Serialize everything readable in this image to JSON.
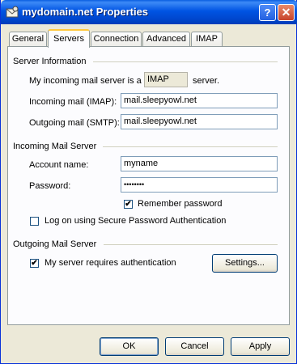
{
  "window": {
    "title": "mydomain.net Properties",
    "help_glyph": "?",
    "close_glyph": "✕",
    "accent": "#0054e3"
  },
  "tabs": [
    {
      "label": "General",
      "active": false
    },
    {
      "label": "Servers",
      "active": true
    },
    {
      "label": "Connection",
      "active": false
    },
    {
      "label": "Advanced",
      "active": false
    },
    {
      "label": "IMAP",
      "active": false
    }
  ],
  "server_info": {
    "heading": "Server Information",
    "incoming_prefix": "My incoming mail server is a",
    "server_type": "IMAP",
    "incoming_suffix": "server.",
    "incoming_label": "Incoming mail (IMAP):",
    "incoming_value": "mail.sleepyowl.net",
    "outgoing_label": "Outgoing mail (SMTP):",
    "outgoing_value": "mail.sleepyowl.net"
  },
  "incoming_server": {
    "heading": "Incoming Mail Server",
    "account_label": "Account name:",
    "account_value": "myname",
    "password_label": "Password:",
    "password_value": "••••••••",
    "remember_label": "Remember password",
    "remember_checked": true,
    "spa_label": "Log on using Secure Password Authentication",
    "spa_checked": false
  },
  "outgoing_server": {
    "heading": "Outgoing Mail Server",
    "auth_label": "My server requires authentication",
    "auth_checked": true,
    "settings_label": "Settings..."
  },
  "footer": {
    "ok_label": "OK",
    "cancel_label": "Cancel",
    "apply_label": "Apply"
  },
  "check_glyph": "✔"
}
